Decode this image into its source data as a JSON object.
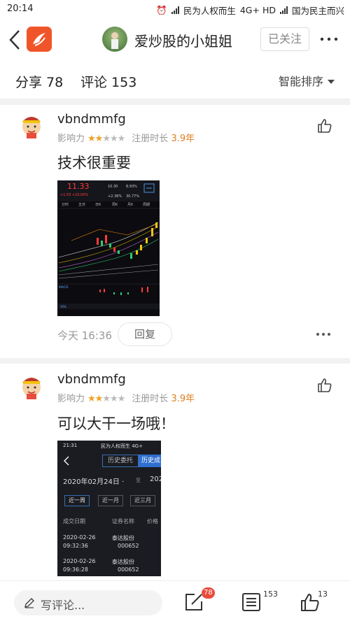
{
  "status_bar": {
    "time": "20:14",
    "carrier1": "民为人权而生",
    "network": "4G+ HD",
    "carrier2": "国为民主而兴"
  },
  "nav": {
    "title": "爱炒股的小姐姐",
    "follow_label": "已关注"
  },
  "stats": {
    "share_label": "分享 78",
    "comment_label": "评论 153",
    "sort_label": "智能排序"
  },
  "comments": [
    {
      "username": "vbndmmfg",
      "influence_label": "影响力",
      "stars_on": "★★",
      "stars_off": "★★★",
      "reg_label": "注册时长",
      "reg_value": "3.9年",
      "text": "技术很重要",
      "time": "今天 16:36",
      "reply_label": "回复",
      "image": {
        "price": "11.33",
        "change": "+1.03 +10.00%",
        "vals": [
          "10.30",
          "8.93%",
          "+2.38%",
          "30.77%"
        ],
        "tabs": [
          "分时",
          "五日",
          "日K",
          "周K",
          "月K",
          "周期"
        ],
        "macd_label": "MACD",
        "vol_label": "VOL"
      }
    },
    {
      "username": "vbndmmfg",
      "influence_label": "影响力",
      "stars_on": "★★",
      "stars_off": "★★★",
      "reg_label": "注册时长",
      "reg_value": "3.9年",
      "text": "可以大干一场哦！",
      "image": {
        "time": "21:31",
        "status": "民为人权而生 4G+",
        "tab1": "历史委托",
        "tab2": "历史成",
        "date": "2020年02月24日 ·",
        "date_to": "至",
        "date_to_val": "202",
        "ranges": [
          "近一周",
          "近一月",
          "近三月"
        ],
        "headers": [
          "成交日期",
          "证券名称",
          "价格"
        ],
        "rows": [
          {
            "date": "2020-02-26",
            "time": "09:32:36",
            "name": "泰达股份",
            "code": "000652"
          },
          {
            "date": "2020-02-26",
            "time": "09:36:28",
            "name": "泰达股份",
            "code": "000652"
          }
        ]
      }
    }
  ],
  "bottom_bar": {
    "placeholder": "写评论...",
    "share_count": "78",
    "comment_count": "153",
    "like_count": "13"
  },
  "colors": {
    "accent_orange": "#f0552a",
    "star": "#f0a020",
    "reg_years": "#e07d1e",
    "badge_red": "#e74c3c"
  }
}
